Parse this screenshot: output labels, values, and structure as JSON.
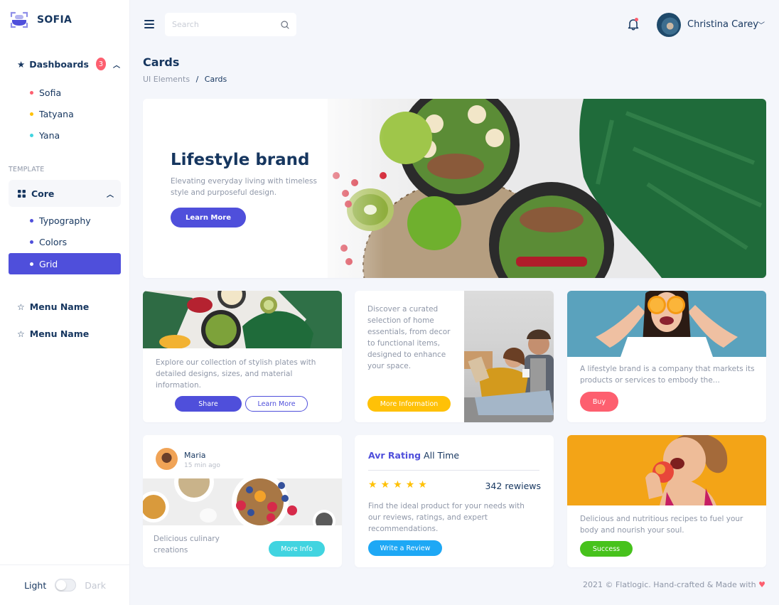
{
  "brand": {
    "name": "SOFIA",
    "accent": "#4f4fdb"
  },
  "sidebar": {
    "dashboards": {
      "label": "Dashboards",
      "badge": "3",
      "items": [
        {
          "label": "Sofia",
          "dot_color": "#fd5f6f"
        },
        {
          "label": "Tatyana",
          "dot_color": "#ffc107"
        },
        {
          "label": "Yana",
          "dot_color": "#41d4e0"
        }
      ]
    },
    "section_label": "TEMPLATE",
    "core": {
      "label": "Core",
      "items": [
        {
          "label": "Typography",
          "active": false
        },
        {
          "label": "Colors",
          "active": false
        },
        {
          "label": "Grid",
          "active": true
        }
      ]
    },
    "menu_items": [
      {
        "label": "Menu Name"
      },
      {
        "label": "Menu Name"
      }
    ],
    "theme": {
      "light_label": "Light",
      "dark_label": "Dark",
      "dark_enabled": false
    }
  },
  "header": {
    "search_placeholder": "Search",
    "search_value": "",
    "user_name": "Christina Carey",
    "has_notifications": true
  },
  "page": {
    "title": "Cards",
    "breadcrumb": [
      "UI Elements",
      "Cards"
    ]
  },
  "hero": {
    "title": "Lifestyle brand",
    "description": "Elevating everyday living with timeless style and purposeful design.",
    "button": "Learn More"
  },
  "cards": {
    "plates": {
      "text": "Explore our collection of stylish plates with detailed designs, sizes, and material information.",
      "primary_button": "Share",
      "secondary_button": "Learn More"
    },
    "home": {
      "text": "Discover a curated selection of home essentials, from decor to functional items, designed to enhance your space.",
      "button": "More Information"
    },
    "lifestyle": {
      "text": "A lifestyle brand is a company that markets its products or services to embody the...",
      "button": "Buy"
    },
    "culinary": {
      "author": "Maria",
      "time": "15 min ago",
      "text": "Delicious culinary creations",
      "button": "More Info"
    },
    "rating": {
      "title_accent": "Avr Rating",
      "title_rest": "All Time",
      "stars": 5,
      "max_stars": 5,
      "reviews": "342 rewiews",
      "text": "Find the ideal product for your needs with our reviews, ratings, and expert recommendations.",
      "button": "Write a Review"
    },
    "recipes": {
      "text": "Delicious and nutritious recipes to fuel your body and nourish your soul.",
      "button": "Success"
    }
  },
  "footer": {
    "text": "2021 © Flatlogic. Hand-crafted & Made with",
    "heart": "♥"
  }
}
